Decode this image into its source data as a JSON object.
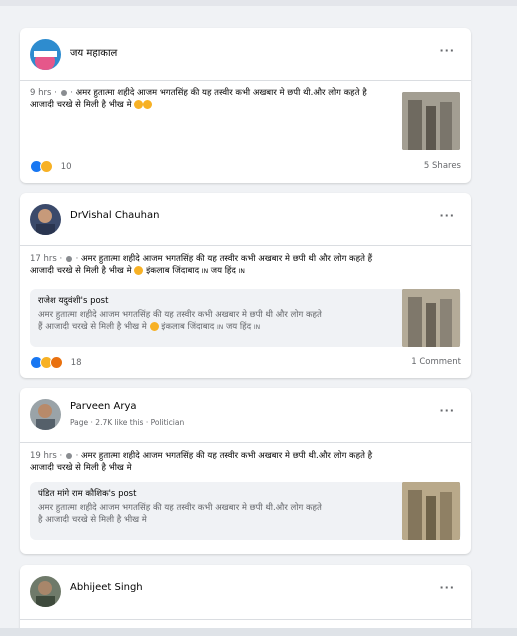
{
  "feed": {
    "posts": [
      {
        "author": "जय महाकाल",
        "time": "9 hrs",
        "text": "अमर हुतात्मा शहीदे आजम भगतसिंह की यह तस्वीर कभी अखबार मे छपी थी.और लोग कहते है आजादी चरखे से मिली है भीख मे",
        "reaction_count": "10",
        "shares": "5 Shares"
      },
      {
        "author": "DrVishal Chauhan",
        "time": "17 hrs",
        "text_line1": "अमर हुतात्मा शहीदे आजम भगतसिंह की यह तस्वीर कभी अखबार मे छपी थी और लोग कहते हैं",
        "text_line2": "आजादी चरखे से मिली है भीख मे",
        "text_line2_tail": "इंकलाब जिंदाबाद",
        "in1": "IN",
        "jay": "जय हिंद",
        "in2": "IN",
        "shared_author": "राजेश यदुवंशी's post",
        "shared_line1": "अमर हुतात्मा शहीदे आजम भगतसिंह की यह तस्वीर कभी अखबार मे छपी थी और लोग कहते",
        "shared_line2": "हैं आजादी चरखे से मिली है भीख मे",
        "shared_tail": "इंकलाब जिंदाबाद",
        "shared_in1": "IN",
        "shared_jay": "जय हिंद",
        "shared_in2": "IN",
        "reaction_count": "18",
        "comments": "1 Comment"
      },
      {
        "author": "Parveen Arya",
        "meta": "Page · 2.7K like this · Politician",
        "time": "19 hrs",
        "text_line1": "अमर हुतात्मा शहीदे आजम भगतसिंह की यह तस्वीर कभी अखबार मे छपी थी.और लोग कहते है",
        "text_line2": "आजादी चरखे से मिली है भीख मे",
        "shared_author": "पंडित मांगे राम कौशिक's post",
        "shared_line1": "अमर हुतात्मा शहीदे आजम भगतसिंह की यह तस्वीर कभी अखबार मे छपी थी.और लोग कहते",
        "shared_line2": "है आजादी चरखे से मिली है भीख मे"
      },
      {
        "author": "Abhijeet Singh"
      }
    ]
  },
  "icons": {
    "more": "more-horizontal-icon",
    "privacy": "globe-icon"
  }
}
